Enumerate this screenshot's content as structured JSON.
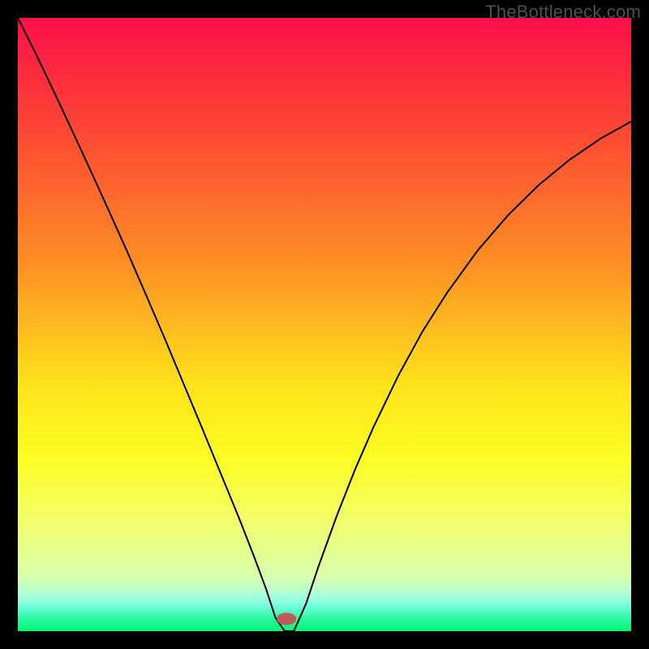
{
  "watermark": "TheBottleneck.com",
  "chart_data": {
    "type": "line",
    "title": "",
    "xlabel": "",
    "ylabel": "",
    "xlim": [
      0,
      100
    ],
    "ylim": [
      0,
      100
    ],
    "grid": false,
    "background_gradient": {
      "stops": [
        {
          "offset": 0.0,
          "color": "#fc1049"
        },
        {
          "offset": 0.17,
          "color": "#fd4335"
        },
        {
          "offset": 0.4,
          "color": "#fd8f24"
        },
        {
          "offset": 0.6,
          "color": "#fee31b"
        },
        {
          "offset": 0.72,
          "color": "#fcfd23"
        },
        {
          "offset": 0.82,
          "color": "#f3fe6a"
        },
        {
          "offset": 0.912,
          "color": "#d8feae"
        },
        {
          "offset": 0.935,
          "color": "#b8fed0"
        },
        {
          "offset": 0.952,
          "color": "#8dfde2"
        },
        {
          "offset": 0.965,
          "color": "#5ffbd0"
        },
        {
          "offset": 0.975,
          "color": "#3af9ac"
        },
        {
          "offset": 1.0,
          "color": "#00f673"
        }
      ]
    },
    "series": [
      {
        "name": "bottleneck-curve",
        "color": "#000000",
        "stroke_width": 2,
        "x": [
          0,
          3,
          6,
          9,
          12,
          15,
          18,
          21,
          24,
          27,
          30,
          33,
          36,
          38.5,
          40.5,
          42,
          43.5,
          45,
          47,
          49,
          52,
          55,
          58,
          62,
          66,
          70,
          75,
          80,
          85,
          90,
          95,
          100
        ],
        "y": [
          100,
          94,
          87.7,
          81.3,
          74.8,
          68.2,
          61.5,
          54.6,
          47.6,
          40.4,
          33.2,
          25.9,
          18.6,
          12.2,
          6.8,
          2.2,
          0.0,
          0.0,
          4.5,
          10.5,
          18.8,
          26.4,
          33.3,
          41.6,
          48.9,
          55.2,
          62.1,
          67.9,
          72.8,
          76.9,
          80.3,
          83.1
        ]
      }
    ],
    "marker": {
      "name": "optimal-point",
      "x": 43.8,
      "y": 2.0,
      "rx": 1.6,
      "ry": 1.0,
      "color": "#c15a5a"
    }
  }
}
